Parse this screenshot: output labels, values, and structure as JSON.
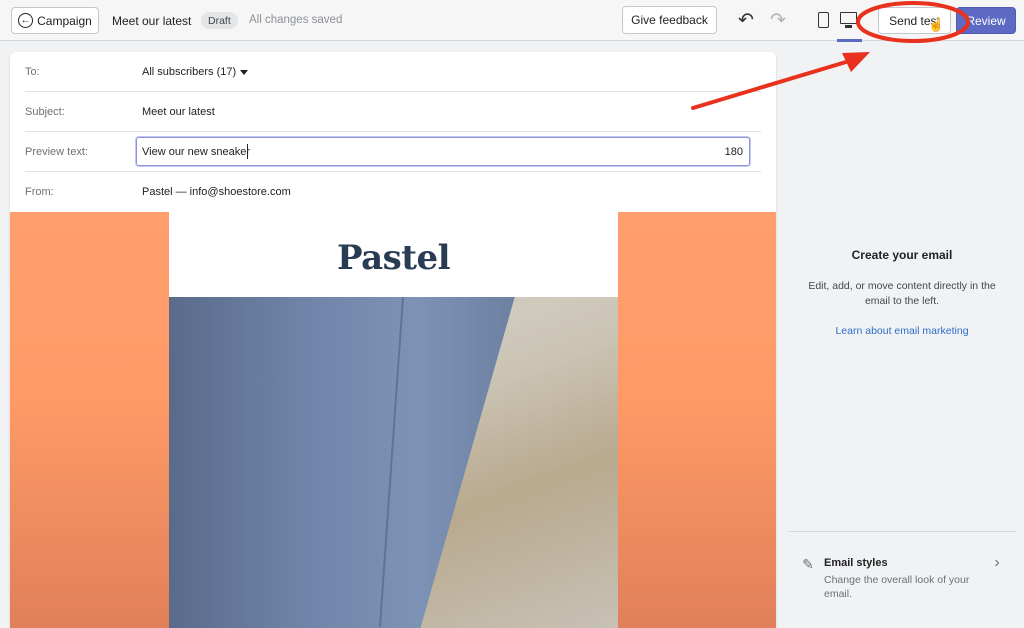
{
  "topbar": {
    "back_label": "Campaign",
    "title": "Meet our latest",
    "status_badge": "Draft",
    "save_status": "All changes saved",
    "feedback_label": "Give feedback",
    "send_test_label": "Send test",
    "review_label": "Review"
  },
  "email": {
    "to_label": "To:",
    "to_value": "All subscribers (17)",
    "subject_label": "Subject:",
    "subject_value": "Meet our latest",
    "preview_label": "Preview text:",
    "preview_value": "View our new sneaker",
    "preview_counter": "180",
    "from_label": "From:",
    "from_value": "Pastel — info@shoestore.com",
    "logo_text": "Pastel"
  },
  "panel": {
    "title": "Create your email",
    "description": "Edit, add, or move content directly in the email to the left.",
    "link": "Learn about email marketing",
    "styles_title": "Email styles",
    "styles_description": "Change the overall look of your email."
  },
  "colors": {
    "accent": "#5c6ac4",
    "annotation": "#e8321e",
    "canvas_background": "#ff9f6e",
    "logo": "#2a3b54",
    "link": "#2c6ecb"
  },
  "icons": [
    "back-arrow-icon",
    "undo-icon",
    "redo-icon",
    "mobile-preview-icon",
    "desktop-preview-icon",
    "dropdown-caret-icon",
    "email-styles-icon",
    "chevron-right-icon",
    "pointer-cursor-icon"
  ]
}
